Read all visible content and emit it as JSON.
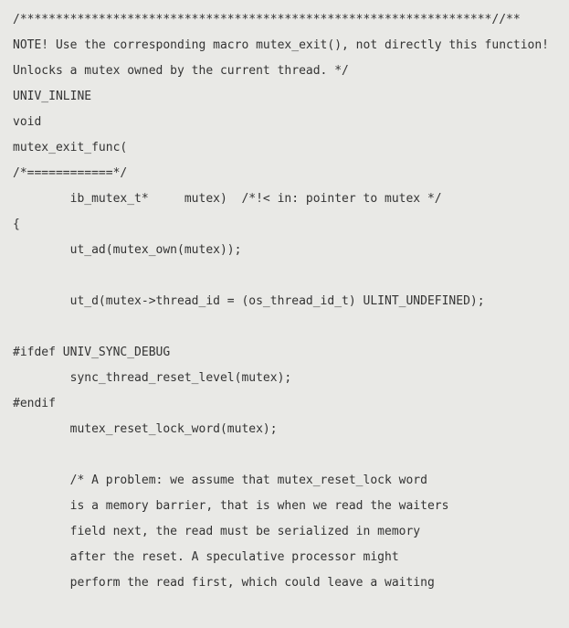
{
  "code": {
    "lines": [
      "/******************************************************************//**",
      "NOTE! Use the corresponding macro mutex_exit(), not directly this function!",
      "Unlocks a mutex owned by the current thread. */",
      "UNIV_INLINE",
      "void",
      "mutex_exit_func(",
      "/*============*/",
      "        ib_mutex_t*     mutex)  /*!< in: pointer to mutex */",
      "{",
      "        ut_ad(mutex_own(mutex));",
      "",
      "        ut_d(mutex->thread_id = (os_thread_id_t) ULINT_UNDEFINED);",
      "",
      "#ifdef UNIV_SYNC_DEBUG",
      "        sync_thread_reset_level(mutex);",
      "#endif",
      "        mutex_reset_lock_word(mutex);",
      "",
      "        /* A problem: we assume that mutex_reset_lock word",
      "        is a memory barrier, that is when we read the waiters",
      "        field next, the read must be serialized in memory",
      "        after the reset. A speculative processor might",
      "        perform the read first, which could leave a waiting"
    ]
  }
}
